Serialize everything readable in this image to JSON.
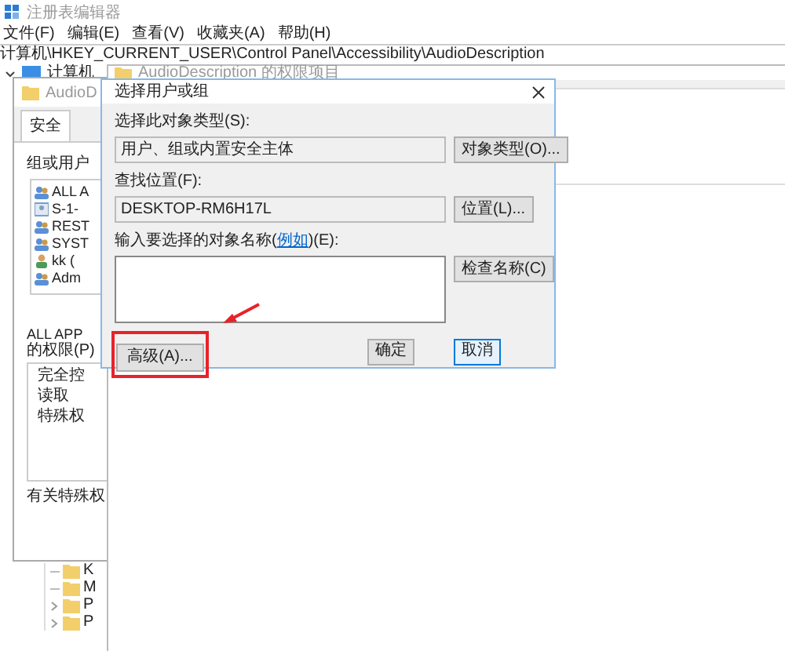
{
  "registry_window": {
    "title": "注册表编辑器",
    "menu": [
      "文件(F)",
      "编辑(E)",
      "查看(V)",
      "收藏夹(A)",
      "帮助(H)"
    ],
    "address": "计算机\\HKEY_CURRENT_USER\\Control Panel\\Accessibility\\AudioDescription",
    "tree": {
      "root": "计算机",
      "expanded": true,
      "items": [
        {
          "label": "K",
          "kind": "leaf"
        },
        {
          "label": "M",
          "kind": "leaf"
        },
        {
          "label": "P",
          "kind": "collapsed"
        },
        {
          "label": "P",
          "kind": "collapsed"
        }
      ]
    }
  },
  "permissions_dialog": {
    "title": "AudioD",
    "tabs": [
      {
        "label": "安全",
        "selected": true
      }
    ],
    "users_label": "组或用户",
    "users": [
      {
        "label": "ALL A",
        "kind": "group"
      },
      {
        "label": "S-1-",
        "kind": "sid"
      },
      {
        "label": "REST",
        "kind": "group"
      },
      {
        "label": "SYST",
        "kind": "group"
      },
      {
        "label": "kk (",
        "kind": "user"
      },
      {
        "label": "Adm",
        "kind": "group"
      }
    ],
    "permissions_label": [
      "ALL APP",
      "的权限(P)"
    ],
    "permissions": [
      "完全控",
      "读取",
      "特殊权"
    ],
    "footer": "有关特殊权"
  },
  "entry_window": {
    "title": "AudioDescription 的权限项目"
  },
  "select_dialog": {
    "title": "选择用户或组",
    "object_type_label": "选择此对象类型(S):",
    "object_type": "用户、组或内置安全主体",
    "object_type_button": "对象类型(O)...",
    "location_label": "查找位置(F):",
    "location": "DESKTOP-RM6H17L",
    "location_button": "位置(L)...",
    "names_label_before": "输入要选择的对象名称(",
    "names_label_link": "例如",
    "names_label_after": ")(E):",
    "check_names_button": "检查名称(C)",
    "advanced_button": "高级(A)...",
    "ok_button": "确定",
    "cancel_button": "取消"
  }
}
